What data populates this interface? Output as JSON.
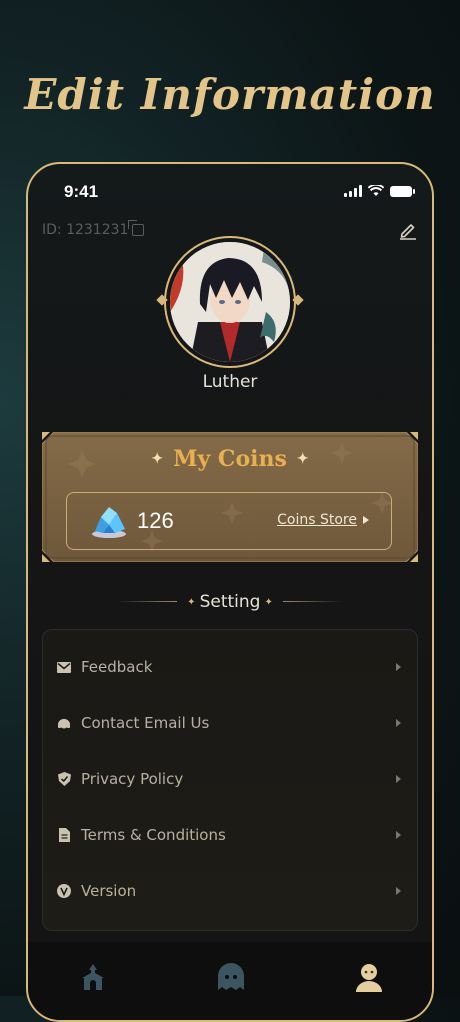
{
  "header": {
    "title": "Edit Information"
  },
  "status_bar": {
    "time": "9:41"
  },
  "profile": {
    "id_text": "ID: 1231231",
    "username": "Luther"
  },
  "coins": {
    "title": "My Coins",
    "amount": "126",
    "store_label": "Coins Store"
  },
  "settings": {
    "heading": "Setting",
    "items": [
      {
        "label": "Feedback",
        "icon": "envelope-icon"
      },
      {
        "label": "Contact Email Us",
        "icon": "headset-icon"
      },
      {
        "label": "Privacy Policy",
        "icon": "shield-check-icon"
      },
      {
        "label": "Terms & Conditions",
        "icon": "document-icon"
      },
      {
        "label": "Version",
        "icon": "version-v-icon"
      }
    ]
  },
  "tabbar": {
    "tabs": [
      {
        "icon": "temple-home-icon",
        "active": false
      },
      {
        "icon": "ghost-chat-icon",
        "active": false
      },
      {
        "icon": "profile-icon",
        "active": true
      }
    ]
  },
  "colors": {
    "gold": "#d8b97a",
    "coin_title": "#e8b04e",
    "panel": "#7a6546"
  }
}
